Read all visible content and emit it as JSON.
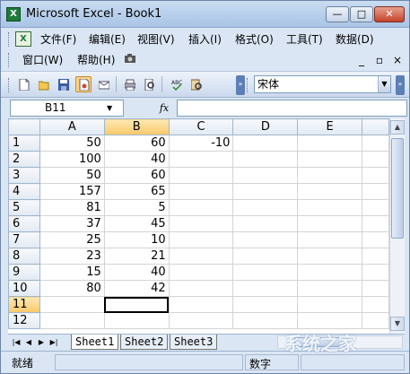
{
  "window": {
    "title": "Microsoft Excel - Book1",
    "app_icon": "excel-icon",
    "buttons": {
      "minimize": "—",
      "maximize": "□",
      "close": "✕"
    }
  },
  "menu": {
    "items": [
      "文件(F)",
      "编辑(E)",
      "视图(V)",
      "插入(I)",
      "格式(O)",
      "工具(T)",
      "数据(D)",
      "窗口(W)",
      "帮助(H)"
    ],
    "doc_controls": {
      "minimize": "_",
      "restore": "▫",
      "close": "×"
    }
  },
  "toolbar": {
    "icons": [
      "new-icon",
      "open-icon",
      "save-icon",
      "permission-icon",
      "print-icon",
      "print-preview-icon",
      "spelling-icon",
      "research-icon"
    ],
    "font_name": "宋体"
  },
  "formula_bar": {
    "name_box": "B11",
    "fx_label": "fx",
    "formula": ""
  },
  "grid": {
    "columns": [
      "A",
      "B",
      "C",
      "D",
      "E"
    ],
    "rows": [
      {
        "num": "1",
        "cells": [
          "50",
          "60",
          "-10",
          "",
          ""
        ]
      },
      {
        "num": "2",
        "cells": [
          "100",
          "40",
          "",
          "",
          ""
        ]
      },
      {
        "num": "3",
        "cells": [
          "50",
          "60",
          "",
          "",
          ""
        ]
      },
      {
        "num": "4",
        "cells": [
          "157",
          "65",
          "",
          "",
          ""
        ]
      },
      {
        "num": "5",
        "cells": [
          "81",
          "5",
          "",
          "",
          ""
        ]
      },
      {
        "num": "6",
        "cells": [
          "37",
          "45",
          "",
          "",
          ""
        ]
      },
      {
        "num": "7",
        "cells": [
          "25",
          "10",
          "",
          "",
          ""
        ]
      },
      {
        "num": "8",
        "cells": [
          "23",
          "21",
          "",
          "",
          ""
        ]
      },
      {
        "num": "9",
        "cells": [
          "15",
          "40",
          "",
          "",
          ""
        ]
      },
      {
        "num": "10",
        "cells": [
          "80",
          "42",
          "",
          "",
          ""
        ]
      },
      {
        "num": "11",
        "cells": [
          "",
          "",
          "",
          "",
          ""
        ]
      },
      {
        "num": "12",
        "cells": [
          "",
          "",
          "",
          "",
          ""
        ]
      }
    ],
    "selected_cell": "B11"
  },
  "sheet_tabs": {
    "tabs": [
      "Sheet1",
      "Sheet2",
      "Sheet3"
    ],
    "active": "Sheet1"
  },
  "status_bar": {
    "left_text": "就绪",
    "mode_text": "数字"
  },
  "watermark": "系统之家"
}
